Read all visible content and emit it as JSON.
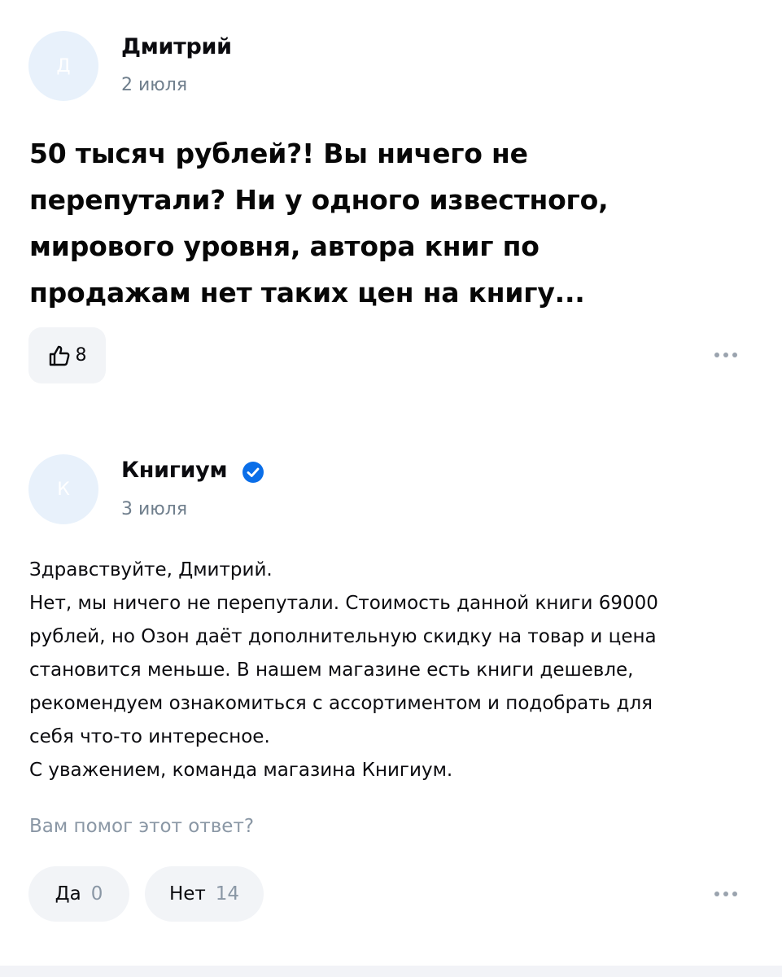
{
  "review": {
    "author": "Дмитрий",
    "avatar_letter": "Д",
    "date": "2 июля",
    "text_lines": [
      "50 тысяч рублей?! Вы ничего не",
      "перепутали? Ни у одного известного,",
      "мирового уровня, автора книг по",
      "продажам нет таких цен на книгу..."
    ],
    "likes": "8",
    "like_icon": "thumbs-up-icon",
    "more_icon": "more-dots-icon"
  },
  "reply": {
    "author": "Книгиум",
    "avatar_letter": "К",
    "verified_icon": "verified-check-icon",
    "verified_color": "#0a6ee8",
    "date": "3 июля",
    "text_lines": [
      "Здравствуйте, Дмитрий.",
      "Нет, мы ничего не перепутали. Стоимость данной книги 69000",
      "рублей, но Озон даёт дополнительную скидку на товар и цена",
      "становится меньше. В нашем магазине есть книги дешевле,",
      "рекомендуем ознакомиться с ассортиментом и подобрать для",
      "себя что-то интересное.",
      "С уважением, команда магазина Книгиум."
    ],
    "helpful_question": "Вам помог этот ответ?",
    "yes_label": "Да",
    "yes_count": "0",
    "no_label": "Нет",
    "no_count": "14",
    "more_icon": "more-dots-icon"
  }
}
